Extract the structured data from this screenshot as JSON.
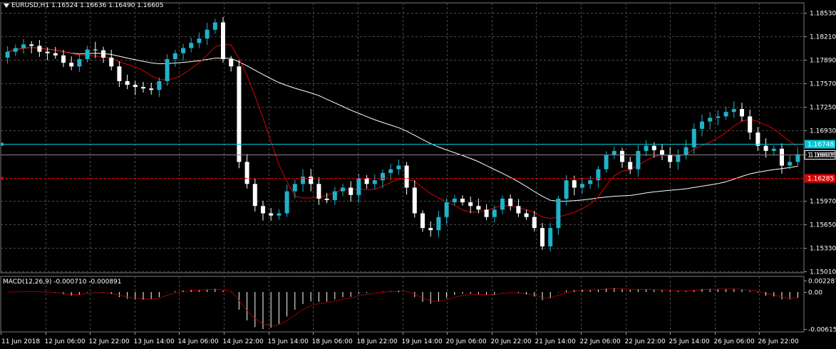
{
  "header": {
    "symbol": "EURUSD,H1",
    "open": "1.16524",
    "high": "1.16636",
    "low": "1.16490",
    "close": "1.16605"
  },
  "macd_header": {
    "label": "MACD(12,26,9)",
    "main": "-0.000710",
    "signal": "-0.000891"
  },
  "price_axis": {
    "ticks": [
      "1.18530",
      "1.18210",
      "1.17890",
      "1.17570",
      "1.17250",
      "1.16930",
      "1.16605",
      "1.15970",
      "1.15650",
      "1.15330",
      "1.15010"
    ],
    "tick_values": [
      1.1853,
      1.1821,
      1.1789,
      1.1757,
      1.1725,
      1.1693,
      1.16605,
      1.1597,
      1.1565,
      1.1533,
      1.1501
    ],
    "ymin": 1.1501,
    "ymax": 1.1853
  },
  "levels": [
    {
      "name": "cyan-level",
      "price": 1.16748,
      "label": "1.16748",
      "color": "#00c8d8"
    },
    {
      "name": "red-level",
      "price": 1.16285,
      "label": "1.16285",
      "color": "#e00000"
    },
    {
      "name": "current-price",
      "price": 1.16605,
      "label": "1.16605",
      "color": "#ffffff"
    }
  ],
  "macd_axis": {
    "ticks": [
      "0.002287",
      "0.00",
      "-0.00615"
    ],
    "tick_values": [
      0.002287,
      0.0,
      -0.00615
    ]
  },
  "time_axis": {
    "labels": [
      "11 Jun 2018",
      "12 Jun 06:00",
      "12 Jun 22:00",
      "13 Jun 14:00",
      "14 Jun 06:00",
      "14 Jun 22:00",
      "15 Jun 14:00",
      "18 Jun 06:00",
      "18 Jun 22:00",
      "19 Jun 14:00",
      "20 Jun 06:00",
      "20 Jun 22:00",
      "21 Jun 14:00",
      "22 Jun 06:00",
      "22 Jun 22:00",
      "25 Jun 14:00",
      "26 Jun 06:00",
      "26 Jun 22:00"
    ]
  },
  "colors": {
    "background": "#000000",
    "grid": "#4a4a4a",
    "bull": "#20b2c8",
    "bear": "#ffffff",
    "ma_slow": "#ffffff",
    "ma_fast": "#e00000",
    "macd_hist": "#ffffff",
    "macd_signal": "#e00000"
  },
  "chart_data": {
    "type": "line",
    "series": [
      {
        "values": [
          1.18,
          1.1805,
          1.181,
          1.1808,
          1.18,
          1.1798,
          1.1795,
          1.1785,
          1.178,
          1.179,
          1.1803,
          1.1802,
          1.1792,
          1.178,
          1.176,
          1.1755,
          1.1752,
          1.175,
          1.1748,
          1.176,
          1.179,
          1.1798,
          1.1805,
          1.1812,
          1.1818,
          1.183,
          1.184,
          1.179,
          1.178,
          1.165,
          1.162,
          1.159,
          1.158,
          1.1577,
          1.158,
          1.161,
          1.162,
          1.163,
          1.162,
          1.16,
          1.1598,
          1.161,
          1.1615,
          1.1605,
          1.1628,
          1.162,
          1.1625,
          1.1635,
          1.164,
          1.1645,
          1.1615,
          1.158,
          1.156,
          1.1557,
          1.1575,
          1.1595,
          1.16,
          1.1595,
          1.159,
          1.1585,
          1.1575,
          1.1585,
          1.16,
          1.159,
          1.158,
          1.1575,
          1.156,
          1.1535,
          1.156,
          1.16,
          1.1625,
          1.1615,
          1.162,
          1.1625,
          1.164,
          1.166,
          1.1665,
          1.165,
          1.164,
          1.1665,
          1.1672,
          1.1666,
          1.166,
          1.165,
          1.166,
          1.167,
          1.1695,
          1.1705,
          1.171,
          1.1712,
          1.1718,
          1.1722,
          1.1712,
          1.169,
          1.1672,
          1.1665,
          1.1668,
          1.1645,
          1.165,
          1.16605
        ]
      }
    ]
  }
}
